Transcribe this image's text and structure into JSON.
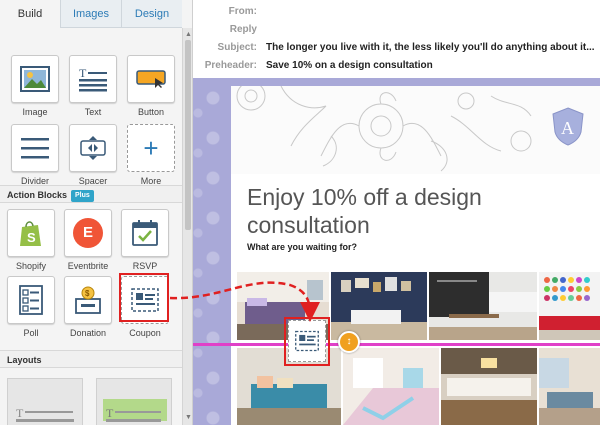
{
  "tabs": [
    {
      "label": "Build",
      "active": true
    },
    {
      "label": "Images",
      "active": false
    },
    {
      "label": "Design",
      "active": false
    }
  ],
  "basic_blocks": [
    {
      "label": "Image",
      "icon": "image-icon"
    },
    {
      "label": "Text",
      "icon": "text-icon"
    },
    {
      "label": "Button",
      "icon": "button-icon"
    },
    {
      "label": "Divider",
      "icon": "divider-icon"
    },
    {
      "label": "Spacer",
      "icon": "spacer-icon"
    },
    {
      "label": "More",
      "icon": "plus-icon"
    }
  ],
  "action_blocks": {
    "title": "Action Blocks",
    "badge": "Plus",
    "items": [
      {
        "label": "Shopify",
        "icon": "shopify-icon"
      },
      {
        "label": "Eventbrite",
        "icon": "eventbrite-icon"
      },
      {
        "label": "RSVP",
        "icon": "rsvp-icon"
      },
      {
        "label": "Poll",
        "icon": "poll-icon"
      },
      {
        "label": "Donation",
        "icon": "donation-icon"
      },
      {
        "label": "Coupon",
        "icon": "coupon-icon"
      }
    ]
  },
  "layouts": {
    "title": "Layouts"
  },
  "email_meta": {
    "from_label": "From:",
    "from_value": "",
    "reply_label": "Reply",
    "reply_value": "",
    "subject_label": "Subject:",
    "subject_value": "The longer you live with it, the less likely you'll do anything about it...",
    "preheader_label": "Preheader:",
    "preheader_value": "Save 10% on a design consultation"
  },
  "email": {
    "crest_letter": "A",
    "headline": "Enjoy 10% off a design consultation",
    "subhead": "What are you waiting for?"
  },
  "eventbrite_letter": "E",
  "drop_handle_glyph": "↕",
  "colors": {
    "accent_blue": "#2c7bb6",
    "plus_badge": "#2fa4c9",
    "drop_line": "#e040c8",
    "drop_handle": "#f0a020",
    "highlight_red": "#e02020",
    "canvas_bg": "#a9a9d8"
  }
}
